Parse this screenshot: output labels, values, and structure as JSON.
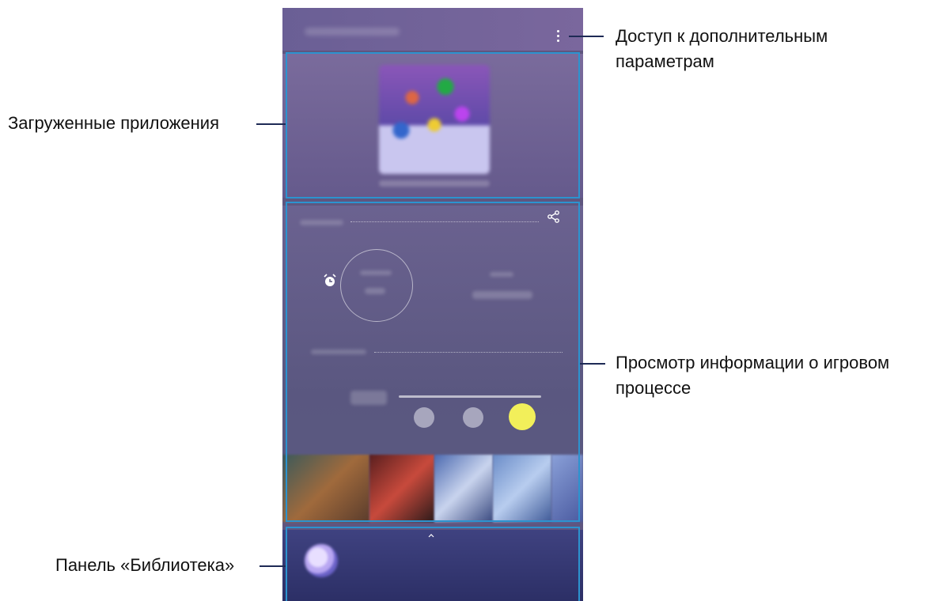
{
  "callouts": {
    "options_line1": "Доступ к дополнительным",
    "options_line2": "параметрам",
    "downloaded_apps": "Загруженные приложения",
    "game_info_line1": "Просмотр информации о игровом",
    "game_info_line2": "процессе",
    "library_panel": "Панель «Библиотека»"
  },
  "colors": {
    "callout_frame": "#2c93cf",
    "leader_line": "#1e2a55",
    "phone_bg": "#5f567f",
    "active_knob": "#f2ef5a"
  },
  "icons": [
    "more-options-icon",
    "share-icon",
    "alarm-clock-icon",
    "chevron-up-icon"
  ]
}
